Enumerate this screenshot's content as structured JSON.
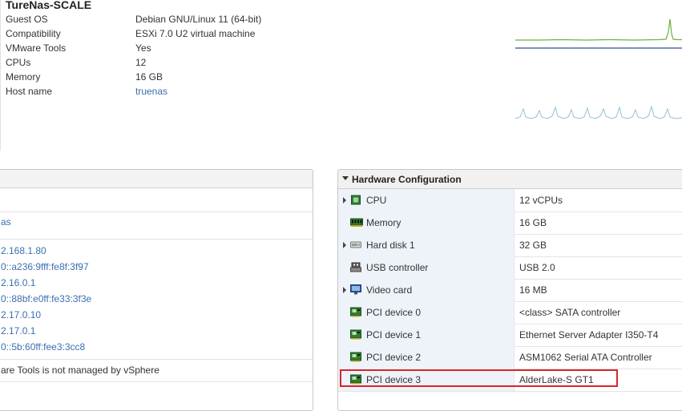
{
  "vm": {
    "title": "TureNas-SCALE"
  },
  "summary": [
    {
      "key": "Guest OS",
      "value": "Debian GNU/Linux 11 (64-bit)"
    },
    {
      "key": "Compatibility",
      "value": "ESXi 7.0 U2 virtual machine"
    },
    {
      "key": "VMware Tools",
      "value": "Yes"
    },
    {
      "key": "CPUs",
      "value": "12"
    },
    {
      "key": "Memory",
      "value": "16 GB"
    },
    {
      "key": "Host name",
      "value": "truenas"
    }
  ],
  "left_panel": {
    "hostname_partial": "as",
    "ip_addresses": [
      "2.168.1.80",
      "0::a236:9fff:fe8f:3f97",
      "2.16.0.1",
      "0::88bf:e0ff:fe33:3f3e",
      "2.17.0.10",
      "2.17.0.1",
      "0::5b:60ff:fee3:3cc8"
    ],
    "tools_note": "are Tools is not managed by vSphere"
  },
  "hardware": {
    "title": "Hardware Configuration",
    "rows": [
      {
        "label": "CPU",
        "value": "12 vCPUs",
        "icon": "cpu-icon",
        "expandable": true
      },
      {
        "label": "Memory",
        "value": "16 GB",
        "icon": "memory-icon",
        "expandable": false
      },
      {
        "label": "Hard disk 1",
        "value": "32 GB",
        "icon": "hard-disk-icon",
        "expandable": true
      },
      {
        "label": "USB controller",
        "value": "USB 2.0",
        "icon": "usb-icon",
        "expandable": false
      },
      {
        "label": "Video card",
        "value": "16 MB",
        "icon": "video-card-icon",
        "expandable": true
      },
      {
        "label": "PCI device 0",
        "value": "<class> SATA controller",
        "icon": "pci-icon",
        "expandable": false
      },
      {
        "label": "PCI device 1",
        "value": "Ethernet Server Adapter I350-T4",
        "icon": "pci-icon",
        "expandable": false
      },
      {
        "label": "PCI device 2",
        "value": "ASM1062 Serial ATA Controller",
        "icon": "pci-icon",
        "expandable": false
      },
      {
        "label": "PCI device 3",
        "value": "AlderLake-S GT1",
        "icon": "pci-icon",
        "expandable": false
      }
    ]
  },
  "colors": {
    "link": "#3a6fb0",
    "sparkline_green": "#6db33f",
    "sparkline_blue": "#2e4d8a",
    "sparkline_lightblue": "#8fc1d9",
    "highlight_red": "#d9252b"
  }
}
